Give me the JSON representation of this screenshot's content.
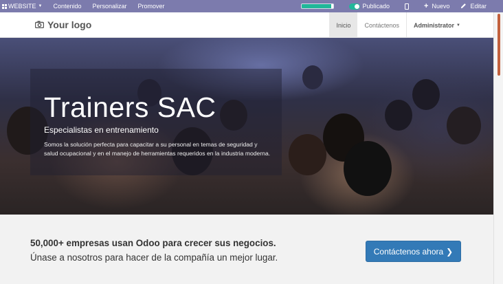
{
  "topbar": {
    "website_label": "WEBSITE",
    "menu": [
      "Contenido",
      "Personalizar",
      "Promover"
    ],
    "publish_progress": 0.95,
    "published_label": "Publicado",
    "new_label": "Nuevo",
    "edit_label": "Editar",
    "bar_color": "#7c7bad",
    "toggle_color": "#21b799"
  },
  "header": {
    "logo_text": "Your logo",
    "nav": [
      {
        "label": "Inicio",
        "active": true
      },
      {
        "label": "Contáctenos",
        "active": false
      },
      {
        "label": "Administrator",
        "active": false
      }
    ]
  },
  "hero": {
    "title": "Trainers SAC",
    "subtitle": "Especialistas en entrenamiento",
    "description": "Somos la solución perfecta para capacitar a su personal en temas de seguridad y salud ocupacional y en el manejo de herramientas requeridos en la industria moderna."
  },
  "cta": {
    "line1": "50,000+ empresas usan Odoo para crecer sus negocios.",
    "line2": "Únase a nosotros para hacer de la compañía un mejor lugar.",
    "button_label": "Contáctenos ahora",
    "button_color": "#337ab7"
  }
}
